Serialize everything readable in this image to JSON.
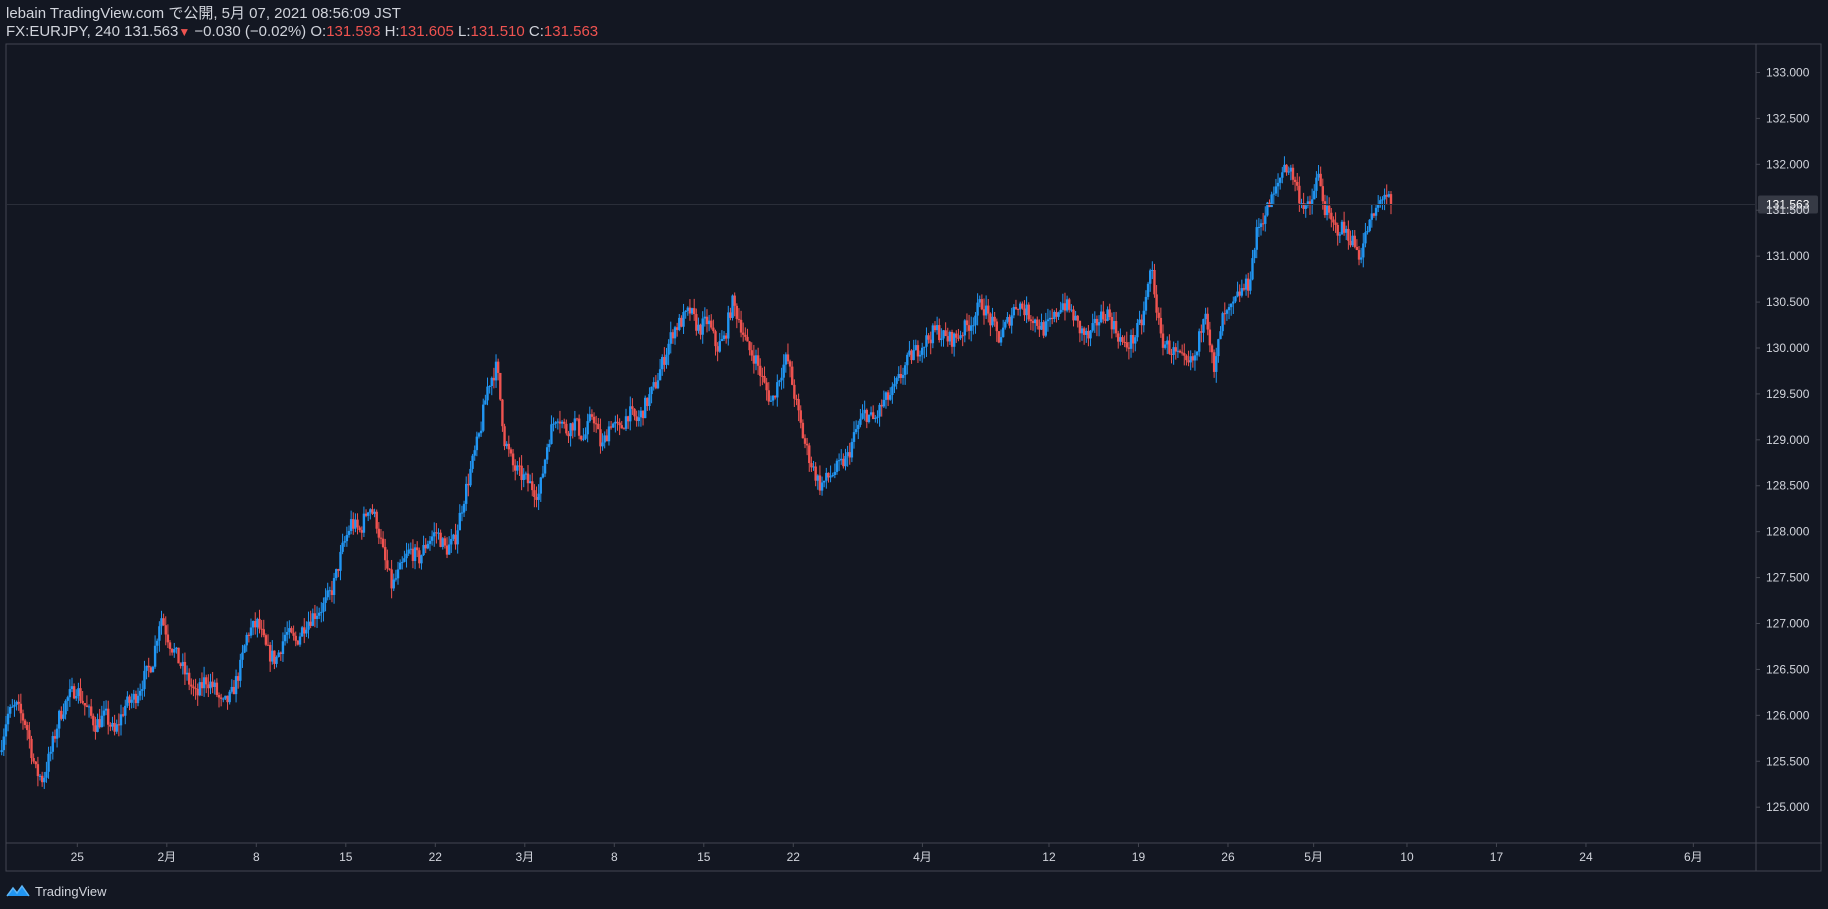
{
  "header": {
    "line1": "lebain TradingView.com で公開, 5月 07, 2021 08:56:09 JST",
    "symbol": "FX:EURJPY, 240",
    "last": "131.563",
    "change_arrow": "▼",
    "change": "−0.030 (−0.02%)",
    "o_label": "O:",
    "o_value": "131.593",
    "h_label": "H:",
    "h_value": "131.605",
    "l_label": "L:",
    "l_value": "131.510",
    "c_label": "C:",
    "c_value": "131.563"
  },
  "footer": {
    "brand": "TradingView"
  },
  "colors": {
    "background": "#131722",
    "up": "#2196f3",
    "down": "#ef5350",
    "axis_text": "#d1d4dc",
    "border": "#434651",
    "price_label_bg": "#363a45"
  },
  "chart_data": {
    "type": "candlestick",
    "symbol": "FX:EURJPY",
    "interval": "240",
    "y_ticks": [
      "133.000",
      "132.500",
      "132.000",
      "131.500",
      "131.000",
      "130.500",
      "130.000",
      "129.500",
      "129.000",
      "128.500",
      "128.000",
      "127.500",
      "127.000",
      "126.500",
      "126.000",
      "125.500",
      "125.000"
    ],
    "ylim": [
      124.61,
      133.31
    ],
    "x_ticks": [
      {
        "label": "25",
        "day": 6
      },
      {
        "label": "2月",
        "day": 13
      },
      {
        "label": "8",
        "day": 20
      },
      {
        "label": "15",
        "day": 27
      },
      {
        "label": "22",
        "day": 34
      },
      {
        "label": "3月",
        "day": 41
      },
      {
        "label": "8",
        "day": 48
      },
      {
        "label": "15",
        "day": 55
      },
      {
        "label": "22",
        "day": 62
      },
      {
        "label": "4月",
        "day": 72.1
      },
      {
        "label": "12",
        "day": 82
      },
      {
        "label": "19",
        "day": 89
      },
      {
        "label": "26",
        "day": 96
      },
      {
        "label": "5月",
        "day": 102.7
      },
      {
        "label": "10",
        "day": 110
      },
      {
        "label": "17",
        "day": 117
      },
      {
        "label": "24",
        "day": 124
      },
      {
        "label": "6月",
        "day": 132.4
      }
    ],
    "x_domain_days": [
      0.5,
      137.3
    ],
    "last_price": "131.563",
    "price_path": [
      [
        0,
        125.6
      ],
      [
        0.6,
        126.0
      ],
      [
        1.3,
        126.1
      ],
      [
        2.1,
        125.9
      ],
      [
        2.8,
        125.4
      ],
      [
        3.4,
        125.3
      ],
      [
        4.0,
        125.6
      ],
      [
        4.7,
        126.0
      ],
      [
        5.4,
        126.2
      ],
      [
        6.0,
        126.3
      ],
      [
        6.7,
        126.1
      ],
      [
        7.5,
        125.9
      ],
      [
        8.3,
        126.0
      ],
      [
        9.0,
        125.8
      ],
      [
        9.8,
        126.1
      ],
      [
        10.6,
        126.2
      ],
      [
        11.3,
        126.4
      ],
      [
        12.0,
        126.6
      ],
      [
        12.6,
        127.1
      ],
      [
        13.3,
        126.8
      ],
      [
        14.0,
        126.6
      ],
      [
        14.7,
        126.4
      ],
      [
        15.4,
        126.2
      ],
      [
        16.1,
        126.4
      ],
      [
        16.8,
        126.3
      ],
      [
        17.4,
        126.1
      ],
      [
        18.1,
        126.2
      ],
      [
        18.8,
        126.5
      ],
      [
        19.4,
        126.9
      ],
      [
        20.2,
        127.0
      ],
      [
        20.9,
        126.7
      ],
      [
        21.6,
        126.6
      ],
      [
        22.4,
        126.9
      ],
      [
        23.2,
        126.8
      ],
      [
        23.9,
        127.0
      ],
      [
        24.6,
        127.1
      ],
      [
        25.4,
        127.2
      ],
      [
        26.1,
        127.4
      ],
      [
        26.8,
        127.8
      ],
      [
        27.5,
        128.1
      ],
      [
        28.2,
        128.0
      ],
      [
        28.9,
        128.3
      ],
      [
        29.5,
        128.1
      ],
      [
        30.1,
        127.7
      ],
      [
        30.7,
        127.4
      ],
      [
        31.4,
        127.6
      ],
      [
        32.1,
        127.8
      ],
      [
        32.8,
        127.7
      ],
      [
        33.5,
        127.9
      ],
      [
        34.2,
        128.0
      ],
      [
        34.9,
        127.8
      ],
      [
        35.6,
        127.9
      ],
      [
        36.2,
        128.3
      ],
      [
        36.9,
        128.7
      ],
      [
        37.6,
        129.1
      ],
      [
        38.2,
        129.6
      ],
      [
        38.9,
        129.8
      ],
      [
        39.5,
        129.0
      ],
      [
        40.2,
        128.7
      ],
      [
        40.9,
        128.6
      ],
      [
        41.6,
        128.5
      ],
      [
        42.2,
        128.4
      ],
      [
        42.9,
        129.0
      ],
      [
        43.6,
        129.3
      ],
      [
        44.3,
        129.1
      ],
      [
        45.0,
        129.2
      ],
      [
        45.7,
        129.0
      ],
      [
        46.4,
        129.3
      ],
      [
        47.1,
        128.9
      ],
      [
        47.8,
        129.2
      ],
      [
        48.5,
        129.1
      ],
      [
        49.2,
        129.3
      ],
      [
        49.9,
        129.2
      ],
      [
        50.6,
        129.4
      ],
      [
        51.3,
        129.6
      ],
      [
        52.0,
        129.9
      ],
      [
        52.7,
        130.2
      ],
      [
        53.4,
        130.3
      ],
      [
        54.0,
        130.4
      ],
      [
        54.7,
        130.2
      ],
      [
        55.4,
        130.3
      ],
      [
        56.1,
        130.0
      ],
      [
        56.7,
        130.1
      ],
      [
        57.3,
        130.5
      ],
      [
        57.9,
        130.3
      ],
      [
        58.5,
        130.0
      ],
      [
        59.1,
        129.9
      ],
      [
        59.8,
        129.6
      ],
      [
        60.4,
        129.4
      ],
      [
        61.0,
        129.7
      ],
      [
        61.6,
        129.9
      ],
      [
        62.3,
        129.4
      ],
      [
        62.9,
        129.0
      ],
      [
        63.6,
        128.7
      ],
      [
        64.2,
        128.5
      ],
      [
        64.9,
        128.6
      ],
      [
        65.6,
        128.7
      ],
      [
        66.3,
        128.8
      ],
      [
        67.0,
        129.1
      ],
      [
        67.7,
        129.3
      ],
      [
        68.4,
        129.2
      ],
      [
        69.1,
        129.4
      ],
      [
        69.8,
        129.5
      ],
      [
        70.5,
        129.7
      ],
      [
        71.2,
        129.9
      ],
      [
        71.9,
        130.0
      ],
      [
        72.6,
        130.1
      ],
      [
        73.3,
        130.2
      ],
      [
        74.0,
        130.1
      ],
      [
        74.7,
        130.1
      ],
      [
        75.4,
        130.2
      ],
      [
        76.1,
        130.3
      ],
      [
        76.8,
        130.5
      ],
      [
        77.5,
        130.3
      ],
      [
        78.2,
        130.1
      ],
      [
        78.9,
        130.3
      ],
      [
        79.6,
        130.5
      ],
      [
        80.3,
        130.4
      ],
      [
        81.0,
        130.3
      ],
      [
        81.7,
        130.2
      ],
      [
        82.4,
        130.3
      ],
      [
        83.1,
        130.5
      ],
      [
        83.8,
        130.4
      ],
      [
        84.5,
        130.2
      ],
      [
        85.2,
        130.1
      ],
      [
        85.9,
        130.3
      ],
      [
        86.6,
        130.4
      ],
      [
        87.3,
        130.2
      ],
      [
        88.0,
        130.0
      ],
      [
        88.7,
        130.1
      ],
      [
        89.4,
        130.3
      ],
      [
        90.1,
        130.9
      ],
      [
        90.8,
        130.1
      ],
      [
        91.5,
        130.0
      ],
      [
        92.2,
        129.9
      ],
      [
        92.9,
        129.8
      ],
      [
        93.6,
        129.9
      ],
      [
        94.3,
        130.5
      ],
      [
        95.0,
        129.7
      ],
      [
        95.6,
        130.3
      ],
      [
        96.3,
        130.4
      ],
      [
        97.0,
        130.6
      ],
      [
        97.7,
        130.7
      ],
      [
        98.4,
        131.3
      ],
      [
        99.1,
        131.5
      ],
      [
        99.8,
        131.7
      ],
      [
        100.5,
        132.0
      ],
      [
        101.1,
        131.9
      ],
      [
        101.8,
        131.6
      ],
      [
        102.5,
        131.5
      ],
      [
        103.1,
        131.9
      ],
      [
        103.7,
        131.5
      ],
      [
        104.4,
        131.3
      ],
      [
        105.0,
        131.3
      ],
      [
        105.7,
        131.2
      ],
      [
        106.4,
        131.0
      ],
      [
        107.0,
        131.3
      ],
      [
        107.7,
        131.5
      ],
      [
        108.3,
        131.7
      ],
      [
        108.8,
        131.563
      ]
    ]
  }
}
